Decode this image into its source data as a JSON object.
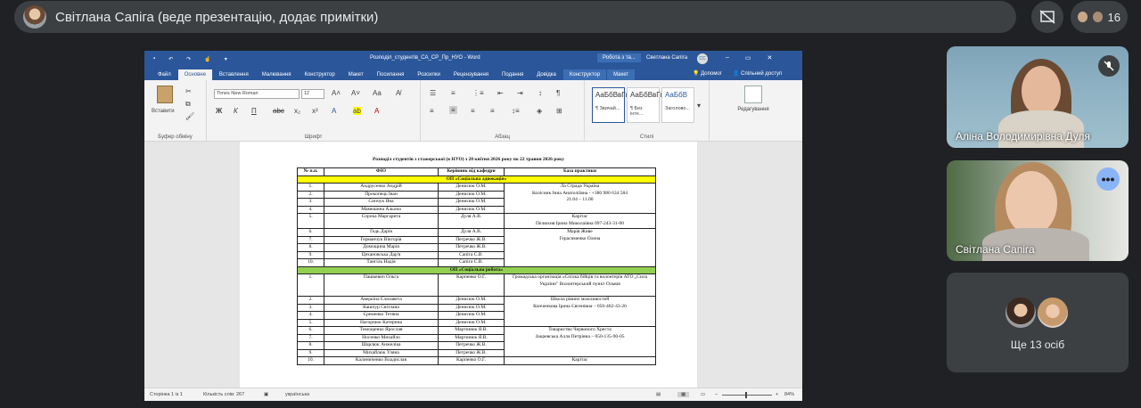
{
  "meet": {
    "presenter_label": "Світлана Сапіга (веде презентацію, додає примітки)",
    "people_count": "16",
    "tiles": [
      {
        "name": "Аліна Володимирівна Дуля",
        "muted": true
      },
      {
        "name": "Світлана Сапіга",
        "menu": "•••"
      },
      {
        "more_label": "Ще 13 осіб"
      }
    ]
  },
  "word": {
    "doc_title": "Розподіл_студентів_СА_СР_Пр_НУО  -  Word",
    "context_tab": "Робота з та...",
    "user": "Светлана Сапіга",
    "user_initials": "СС",
    "tabs": [
      "Файл",
      "Основне",
      "Вставлення",
      "Малювання",
      "Конструктор",
      "Макет",
      "Посилання",
      "Розсилки",
      "Рецензування",
      "Подання",
      "Довідка",
      "Конструктор",
      "Макет"
    ],
    "active_tab": "Основне",
    "help": "Допомог",
    "share": "Спільний доступ",
    "ribbon": {
      "clipboard_label": "Буфер обміну",
      "paste": "Вставити",
      "font_label": "Шрифт",
      "font_name": "Times New Roman",
      "font_size": "12",
      "paragraph_label": "Абзац",
      "styles_label": "Стилі",
      "styles": [
        {
          "preview": "АаБбВвГг,",
          "name": "¶ Звичай..."
        },
        {
          "preview": "АаБбВвГг,",
          "name": "¶ Без інте..."
        },
        {
          "preview": "АаБбВ",
          "name": "Заголово..."
        }
      ],
      "editing": "Редагування"
    },
    "status": {
      "page": "Сторінка 1 із 1",
      "words": "Кількість слів: 267",
      "lang": "українська",
      "zoom": "84%"
    }
  },
  "document": {
    "title": "Розподіл студентів з стажерської (в НУО) з 20 квітня 2026 року по 22 травня 2026 року",
    "headers": [
      "№ п.п.",
      "ФІО",
      "Керівник від кафедри",
      "База практики"
    ],
    "section1": "ОП «Соціальна адвокація»",
    "section2": "ОП «Соціальна робота»",
    "rows1": [
      {
        "n": "1.",
        "name": "Андрусенко Андрій",
        "sup": "Денисюк О.М."
      },
      {
        "n": "2.",
        "name": "Прокопець Іван",
        "sup": "Денисюк О.М."
      },
      {
        "n": "3.",
        "name": "Сипчук Яна",
        "sup": "Денисюк О.М."
      },
      {
        "n": "4.",
        "name": "Мамешина Альона",
        "sup": "Денисюк О.М."
      },
      {
        "n": "5.",
        "name": "Сорока Маргарита",
        "sup": "Дуля А.В."
      },
      {
        "n": "6.",
        "name": "Гедь Дарія",
        "sup": "Дуля А.В."
      },
      {
        "n": "7.",
        "name": "Германчук Вікторія",
        "sup": "Петречко Ж.В."
      },
      {
        "n": "8.",
        "name": "Домощина Марія",
        "sup": "Петречко Ж.В."
      },
      {
        "n": "9.",
        "name": "Цехановська Дар'я",
        "sup": "Сапіга С.В."
      },
      {
        "n": "10.",
        "name": "Тангіль Надія",
        "sup": "Сапіга С.В."
      }
    ],
    "bases1": [
      "Ла Страда Україна",
      "Колісник Інна  Анатоліївна - +380 980 634 584",
      "21.04 – 11.00",
      "Карітас",
      "Пелюхня Ірина Миколаївна 097-243-31-00",
      "Марія Живе",
      "Герасименко Олена"
    ],
    "rows2": [
      {
        "n": "1.",
        "name": "Пашкевич Ольга",
        "sup": "Карпенко О.Г."
      },
      {
        "n": "2.",
        "name": "Аверкіна Єлизавета",
        "sup": "Денисюк О.М."
      },
      {
        "n": "3.",
        "name": "Кашпур Світлана",
        "sup": "Денисюк О.М."
      },
      {
        "n": "4.",
        "name": "Єременко Тетяна",
        "sup": "Денисюк О.М."
      },
      {
        "n": "5.",
        "name": "Нагорнюк Катерина",
        "sup": "Денисюк О.М."
      },
      {
        "n": "6.",
        "name": "Тимощенко Ярослав",
        "sup": "Мартинюк Я.В."
      },
      {
        "n": "7.",
        "name": "Носенко Михайло",
        "sup": "Мартинюк Я.В."
      },
      {
        "n": "8.",
        "name": "Шарлюк Анжеліка",
        "sup": "Петречко Ж.В."
      },
      {
        "n": "9.",
        "name": "Михайлюк Уляна",
        "sup": "Петречко Ж.В."
      },
      {
        "n": "10.",
        "name": "Калиниченко Владислав",
        "sup": "Карпенко О.Г."
      }
    ],
    "bases2": [
      "Громадська організація «Спілка бійців та волонтерів АТО „Сила України\" Волонтерський пункт Ольвія",
      "Школа рівних можливостей",
      "Конченкова Ірина Євгенівна – 050-462-43-26",
      "Товариство Червоного Хреста",
      "Закревська Алла Петрівна – 050-135-90-05",
      "Карітас"
    ]
  }
}
